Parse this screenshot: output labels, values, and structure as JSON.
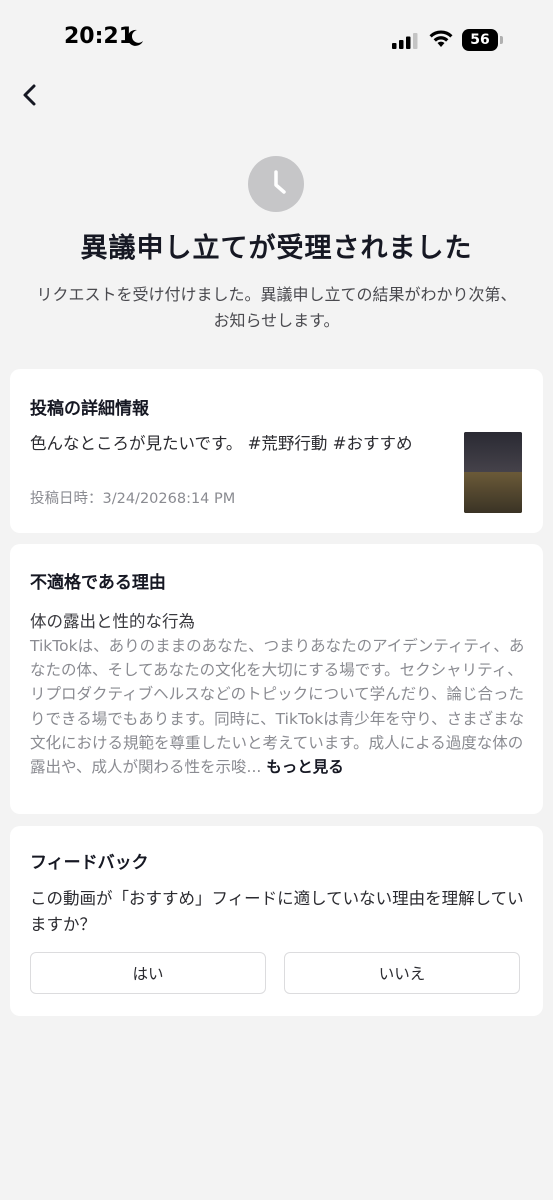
{
  "status_bar": {
    "time": "20:21",
    "battery": "56"
  },
  "header": {
    "title": "異議申し立てが受理されました",
    "subtitle": "リクエストを受け付けました。異議申し立ての結果がわかり次第、お知らせします。"
  },
  "post_details": {
    "heading": "投稿の詳細情報",
    "caption": "色んなところが見たいです。 #荒野行動 #おすすめ",
    "date": "投稿日時：3/24/20268:14 PM"
  },
  "reason": {
    "heading": "不適格である理由",
    "violation": "体の露出と性的な行為",
    "description": "TikTokは、ありのままのあなた、つまりあなたのアイデンティティ、あなたの体、そしてあなたの文化を大切にする場です。セクシャリティ、リプロダクティブヘルスなどのトピックについて学んだり、論じ合ったりできる場でもあります。同時に、TikTokは青少年を守り、さまざまな文化における規範を尊重したいと考えています。成人による過度な体の露出や、成人が関わる性を示唆...",
    "more_label": "もっと見る"
  },
  "feedback": {
    "heading": "フィードバック",
    "question": "この動画が「おすすめ」フィードに適していない理由を理解していますか？",
    "yes_label": "はい",
    "no_label": "いいえ"
  },
  "icons": {
    "back": "chevron-left-icon",
    "status": "clock-icon"
  },
  "colors": {
    "background": "#f3f3f3",
    "card": "#ffffff",
    "icon_gray": "#c6c6c8"
  }
}
